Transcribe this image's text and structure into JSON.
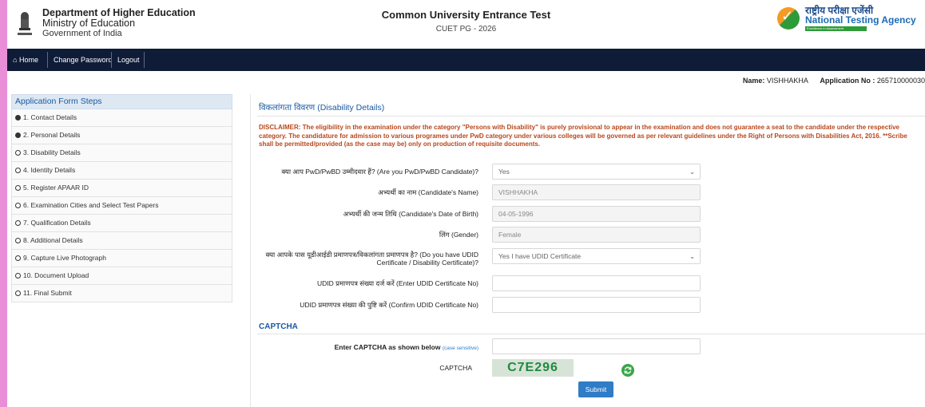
{
  "header": {
    "dept": "Department of Higher Education",
    "ministry": "Ministry of Education",
    "govt": "Government of India",
    "exam_title": "Common University Entrance Test",
    "exam_sub": "CUET PG - 2026",
    "nta_hindi": "राष्ट्रीय परीक्षा एजेंसी",
    "nta_english": "National Testing Agency",
    "nta_tagline": "Excellence in Assessment"
  },
  "nav": {
    "home": "Home",
    "change_password": "Change Password",
    "logout": "Logout"
  },
  "user": {
    "name_label": "Name:",
    "name": "VISHHAKHA",
    "app_label": "Application No :",
    "app_no": "265710000030"
  },
  "sidebar": {
    "title": "Application Form Steps",
    "steps": [
      {
        "label": "1. Contact Details",
        "done": true
      },
      {
        "label": "2. Personal Details",
        "done": true
      },
      {
        "label": "3. Disability Details",
        "done": false
      },
      {
        "label": "4. Identity Details",
        "done": false
      },
      {
        "label": "5. Register APAAR ID",
        "done": false
      },
      {
        "label": "6. Examination Cities and Select Test Papers",
        "done": false
      },
      {
        "label": "7. Qualification Details",
        "done": false
      },
      {
        "label": "8. Additional Details",
        "done": false
      },
      {
        "label": "9. Capture Live Photograph",
        "done": false
      },
      {
        "label": "10. Document Upload",
        "done": false
      },
      {
        "label": "11. Final Submit",
        "done": false
      }
    ]
  },
  "form": {
    "title_hi": "विकलांगता विवरण",
    "title_en": "(Disability Details)",
    "disclaimer": "DISCLAIMER: The eligibility in the examination under the category \"Persons with Disability\" is purely provisional to appear in the examination and does not guarantee a seat to the candidate under the respective category. The candidature for admission to various programes under PwD category under various colleges will be governed as per relevant guidelines under the Right of Persons with Disabilities Act, 2016. **Scribe shall be permitted/provided (as the case may be) only on production of requisite documents.",
    "pwd_label": "क्या आप PwD/PwBD उम्मीदवार हैं? (Are you PwD/PwBD Candidate)?",
    "pwd_value": "Yes",
    "name_label": "अभ्यर्थी का नाम (Candidate's Name)",
    "name_value": "VISHHAKHA",
    "dob_label": "अभ्यर्थी की जन्म तिथि (Candidate's Date of Birth)",
    "dob_value": "04-05-1996",
    "gender_label": "लिंग (Gender)",
    "gender_value": "Female",
    "udid_q_label": "क्या आपके पास यूडीआईडी प्रमाणपत्र/विकलांगता प्रमाणपत्र है? (Do you have UDID Certificate / Disability Certificate)?",
    "udid_q_value": "Yes I have UDID Certificate",
    "udid_no_label": "UDID प्रमाणपत्र संख्या दर्ज करें (Enter UDID Certificate No)",
    "udid_no_value": "",
    "udid_confirm_label": "UDID प्रमाणपत्र संख्या की पुष्टि करें (Confirm UDID Certificate No)",
    "udid_confirm_value": ""
  },
  "captcha": {
    "heading": "CAPTCHA",
    "enter_label": "Enter CAPTCHA as shown below",
    "case_note": "(case sensitive)",
    "input_value": "",
    "captcha_label": "CAPTCHA",
    "captcha_text": "C7E296",
    "submit_label": "Submit"
  },
  "colors": {
    "navbar": "#0e1c38",
    "accent": "#1a5aa0",
    "disclaimer": "#b9471b",
    "submit": "#2f7cc7",
    "captcha_text": "#1e8a3e"
  }
}
